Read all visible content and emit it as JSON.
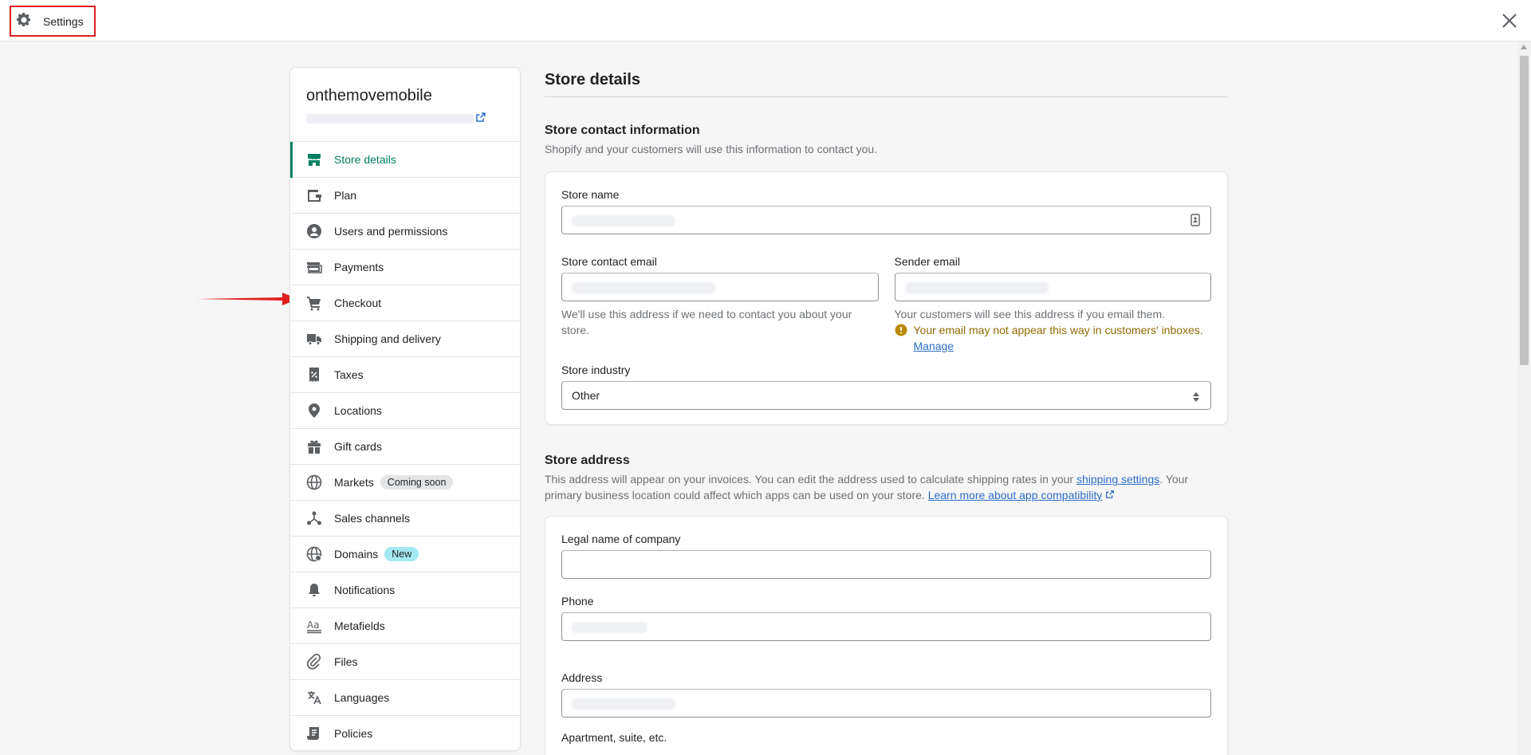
{
  "topbar": {
    "title": "Settings",
    "icons": {
      "settings": "gear-icon",
      "close": "close-icon"
    }
  },
  "sidebar": {
    "store_name": "onthemovemobile",
    "items": [
      {
        "label": "Store details",
        "icon": "store-icon",
        "active": true
      },
      {
        "label": "Plan",
        "icon": "wallet-icon"
      },
      {
        "label": "Users and permissions",
        "icon": "user-icon"
      },
      {
        "label": "Payments",
        "icon": "payments-icon"
      },
      {
        "label": "Checkout",
        "icon": "cart-icon"
      },
      {
        "label": "Shipping and delivery",
        "icon": "truck-icon"
      },
      {
        "label": "Taxes",
        "icon": "taxes-icon"
      },
      {
        "label": "Locations",
        "icon": "location-icon"
      },
      {
        "label": "Gift cards",
        "icon": "gift-icon"
      },
      {
        "label": "Markets",
        "icon": "globe-icon",
        "badge": "Coming soon"
      },
      {
        "label": "Sales channels",
        "icon": "channels-icon"
      },
      {
        "label": "Domains",
        "icon": "domain-globe-icon",
        "badge": "New"
      },
      {
        "label": "Notifications",
        "icon": "bell-icon"
      },
      {
        "label": "Metafields",
        "icon": "metafields-icon"
      },
      {
        "label": "Files",
        "icon": "paperclip-icon"
      },
      {
        "label": "Languages",
        "icon": "translate-icon"
      },
      {
        "label": "Policies",
        "icon": "policy-icon"
      }
    ]
  },
  "main": {
    "page_title": "Store details",
    "contact": {
      "title": "Store contact information",
      "desc": "Shopify and your customers will use this information to contact you.",
      "store_name_label": "Store name",
      "contact_email_label": "Store contact email",
      "contact_email_help": "We'll use this address if we need to contact you about your store.",
      "sender_email_label": "Sender email",
      "sender_email_help": "Your customers will see this address if you email them.",
      "sender_warning": "Your email may not appear this way in customers' inboxes.",
      "manage_link": "Manage",
      "industry_label": "Store industry",
      "industry_value": "Other"
    },
    "address": {
      "title": "Store address",
      "desc_part1": "This address will appear on your invoices. You can edit the address used to calculate shipping rates in your ",
      "shipping_link": "shipping settings",
      "desc_part2": ". Your primary business location could affect which apps can be used on your store. ",
      "learn_link": "Learn more about app compatibility",
      "legal_label": "Legal name of company",
      "phone_label": "Phone",
      "address_label": "Address",
      "apartment_label": "Apartment, suite, etc."
    }
  },
  "colors": {
    "accent": "#008060",
    "link": "#2c6ecb",
    "warning": "#916a00",
    "annotation": "#e02020"
  }
}
